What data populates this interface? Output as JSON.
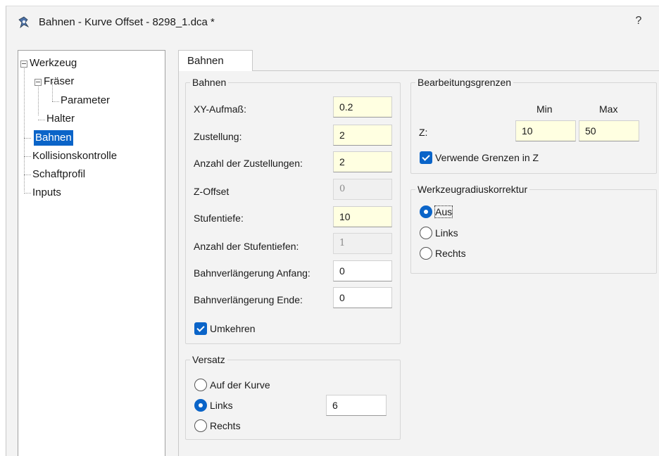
{
  "window": {
    "title": "Bahnen - Kurve Offset - 8298_1.dca *",
    "help_label": "?"
  },
  "tree": {
    "items": [
      {
        "label": "Werkzeug"
      },
      {
        "label": "Fräser"
      },
      {
        "label": "Parameter"
      },
      {
        "label": "Halter"
      },
      {
        "label": "Bahnen",
        "selected": true
      },
      {
        "label": "Kollisionskontrolle"
      },
      {
        "label": "Schaftprofil"
      },
      {
        "label": "Inputs"
      }
    ]
  },
  "tabs": [
    {
      "label": "Bahnen",
      "active": true
    }
  ],
  "bahnen": {
    "title": "Bahnen",
    "xy_aufmass": {
      "label": "XY-Aufmaß:",
      "value": "0.2"
    },
    "zustellung": {
      "label": "Zustellung:",
      "value": "2"
    },
    "anzahl_zustellungen": {
      "label": "Anzahl der Zustellungen:",
      "value": "2"
    },
    "z_offset": {
      "label": "Z-Offset",
      "value": "0"
    },
    "stufentiefe": {
      "label": "Stufentiefe:",
      "value": "10"
    },
    "anzahl_stufentiefen": {
      "label": "Anzahl der Stufentiefen:",
      "value": "1"
    },
    "verlaengerung_anfang": {
      "label": "Bahnverlängerung Anfang:",
      "value": "0"
    },
    "verlaengerung_ende": {
      "label": "Bahnverlängerung Ende:",
      "value": "0"
    },
    "umkehren": {
      "label": "Umkehren",
      "checked": true
    }
  },
  "versatz": {
    "title": "Versatz",
    "options": [
      {
        "label": "Auf der Kurve",
        "checked": false
      },
      {
        "label": "Links",
        "checked": true
      },
      {
        "label": "Rechts",
        "checked": false
      }
    ],
    "value": "6"
  },
  "grenzen": {
    "title": "Bearbeitungsgrenzen",
    "min_label": "Min",
    "max_label": "Max",
    "z_label": "Z:",
    "min_value": "10",
    "max_value": "50",
    "verwende": {
      "label": "Verwende Grenzen in Z",
      "checked": true
    }
  },
  "korrektur": {
    "title": "Werkzeugradiuskorrektur",
    "options": [
      {
        "label": "Aus",
        "checked": true
      },
      {
        "label": "Links",
        "checked": false
      },
      {
        "label": "Rechts",
        "checked": false
      }
    ]
  },
  "colors": {
    "accent": "#0a64c8",
    "input_highlight": "#ffffe1",
    "window_bg": "#f3f3f3"
  }
}
